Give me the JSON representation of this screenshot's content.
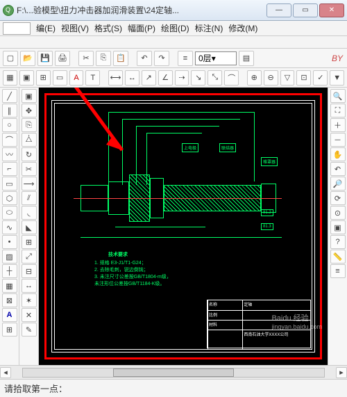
{
  "window": {
    "title": "F:\\...验模型\\扭力冲击器加润滑装置\\24定轴..."
  },
  "menu": {
    "edit": "编(E)",
    "view": "视图(V)",
    "format": "格式(S)",
    "sheet": "幅面(P)",
    "draw": "绘图(D)",
    "annotate": "标注(N)",
    "modify": "修改(M)"
  },
  "layer": {
    "current": "0层"
  },
  "bycolor": "BY",
  "status": {
    "prompt": "请拾取第一点："
  },
  "titleblock": {
    "r1c1": "名称",
    "r1c2": "定轴",
    "r2c1": "比例",
    "r2c2": "",
    "r3c1": "材料",
    "r3c2": "",
    "r4c1": "",
    "r4c2": "西南石油大学XXXX公司"
  },
  "notes": {
    "title": "技术要求",
    "l1": "1. 规格 E3-J1/T1-G24；",
    "l2": "2. 去除毛刺，锐边倒钝；",
    "l3": "3. 未注尺寸公差按GB/T1804-m级，",
    "l4": "   未注形位公差按GB/T1184-K级。"
  },
  "tags": {
    "a": "上电极",
    "b": "联结器",
    "c": "帷罩器"
  },
  "dims": {
    "a": "81.2",
    "b": "81.3"
  },
  "watermark": {
    "main": "Baidu 经验",
    "sub": "jingyan.baidu.com"
  }
}
